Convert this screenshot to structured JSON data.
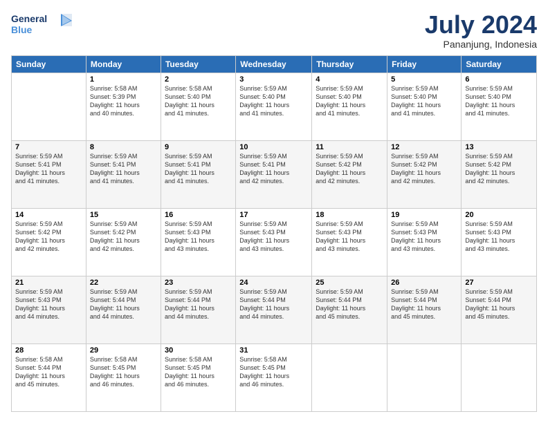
{
  "logo": {
    "line1": "General",
    "line2": "Blue"
  },
  "header": {
    "month": "July 2024",
    "location": "Pananjung, Indonesia"
  },
  "weekdays": [
    "Sunday",
    "Monday",
    "Tuesday",
    "Wednesday",
    "Thursday",
    "Friday",
    "Saturday"
  ],
  "weeks": [
    [
      {
        "day": "",
        "info": ""
      },
      {
        "day": "1",
        "info": "Sunrise: 5:58 AM\nSunset: 5:39 PM\nDaylight: 11 hours\nand 40 minutes."
      },
      {
        "day": "2",
        "info": "Sunrise: 5:58 AM\nSunset: 5:40 PM\nDaylight: 11 hours\nand 41 minutes."
      },
      {
        "day": "3",
        "info": "Sunrise: 5:59 AM\nSunset: 5:40 PM\nDaylight: 11 hours\nand 41 minutes."
      },
      {
        "day": "4",
        "info": "Sunrise: 5:59 AM\nSunset: 5:40 PM\nDaylight: 11 hours\nand 41 minutes."
      },
      {
        "day": "5",
        "info": "Sunrise: 5:59 AM\nSunset: 5:40 PM\nDaylight: 11 hours\nand 41 minutes."
      },
      {
        "day": "6",
        "info": "Sunrise: 5:59 AM\nSunset: 5:40 PM\nDaylight: 11 hours\nand 41 minutes."
      }
    ],
    [
      {
        "day": "7",
        "info": "Sunrise: 5:59 AM\nSunset: 5:41 PM\nDaylight: 11 hours\nand 41 minutes."
      },
      {
        "day": "8",
        "info": "Sunrise: 5:59 AM\nSunset: 5:41 PM\nDaylight: 11 hours\nand 41 minutes."
      },
      {
        "day": "9",
        "info": "Sunrise: 5:59 AM\nSunset: 5:41 PM\nDaylight: 11 hours\nand 41 minutes."
      },
      {
        "day": "10",
        "info": "Sunrise: 5:59 AM\nSunset: 5:41 PM\nDaylight: 11 hours\nand 42 minutes."
      },
      {
        "day": "11",
        "info": "Sunrise: 5:59 AM\nSunset: 5:42 PM\nDaylight: 11 hours\nand 42 minutes."
      },
      {
        "day": "12",
        "info": "Sunrise: 5:59 AM\nSunset: 5:42 PM\nDaylight: 11 hours\nand 42 minutes."
      },
      {
        "day": "13",
        "info": "Sunrise: 5:59 AM\nSunset: 5:42 PM\nDaylight: 11 hours\nand 42 minutes."
      }
    ],
    [
      {
        "day": "14",
        "info": "Sunrise: 5:59 AM\nSunset: 5:42 PM\nDaylight: 11 hours\nand 42 minutes."
      },
      {
        "day": "15",
        "info": "Sunrise: 5:59 AM\nSunset: 5:42 PM\nDaylight: 11 hours\nand 42 minutes."
      },
      {
        "day": "16",
        "info": "Sunrise: 5:59 AM\nSunset: 5:43 PM\nDaylight: 11 hours\nand 43 minutes."
      },
      {
        "day": "17",
        "info": "Sunrise: 5:59 AM\nSunset: 5:43 PM\nDaylight: 11 hours\nand 43 minutes."
      },
      {
        "day": "18",
        "info": "Sunrise: 5:59 AM\nSunset: 5:43 PM\nDaylight: 11 hours\nand 43 minutes."
      },
      {
        "day": "19",
        "info": "Sunrise: 5:59 AM\nSunset: 5:43 PM\nDaylight: 11 hours\nand 43 minutes."
      },
      {
        "day": "20",
        "info": "Sunrise: 5:59 AM\nSunset: 5:43 PM\nDaylight: 11 hours\nand 43 minutes."
      }
    ],
    [
      {
        "day": "21",
        "info": "Sunrise: 5:59 AM\nSunset: 5:43 PM\nDaylight: 11 hours\nand 44 minutes."
      },
      {
        "day": "22",
        "info": "Sunrise: 5:59 AM\nSunset: 5:44 PM\nDaylight: 11 hours\nand 44 minutes."
      },
      {
        "day": "23",
        "info": "Sunrise: 5:59 AM\nSunset: 5:44 PM\nDaylight: 11 hours\nand 44 minutes."
      },
      {
        "day": "24",
        "info": "Sunrise: 5:59 AM\nSunset: 5:44 PM\nDaylight: 11 hours\nand 44 minutes."
      },
      {
        "day": "25",
        "info": "Sunrise: 5:59 AM\nSunset: 5:44 PM\nDaylight: 11 hours\nand 45 minutes."
      },
      {
        "day": "26",
        "info": "Sunrise: 5:59 AM\nSunset: 5:44 PM\nDaylight: 11 hours\nand 45 minutes."
      },
      {
        "day": "27",
        "info": "Sunrise: 5:59 AM\nSunset: 5:44 PM\nDaylight: 11 hours\nand 45 minutes."
      }
    ],
    [
      {
        "day": "28",
        "info": "Sunrise: 5:58 AM\nSunset: 5:44 PM\nDaylight: 11 hours\nand 45 minutes."
      },
      {
        "day": "29",
        "info": "Sunrise: 5:58 AM\nSunset: 5:45 PM\nDaylight: 11 hours\nand 46 minutes."
      },
      {
        "day": "30",
        "info": "Sunrise: 5:58 AM\nSunset: 5:45 PM\nDaylight: 11 hours\nand 46 minutes."
      },
      {
        "day": "31",
        "info": "Sunrise: 5:58 AM\nSunset: 5:45 PM\nDaylight: 11 hours\nand 46 minutes."
      },
      {
        "day": "",
        "info": ""
      },
      {
        "day": "",
        "info": ""
      },
      {
        "day": "",
        "info": ""
      }
    ]
  ]
}
